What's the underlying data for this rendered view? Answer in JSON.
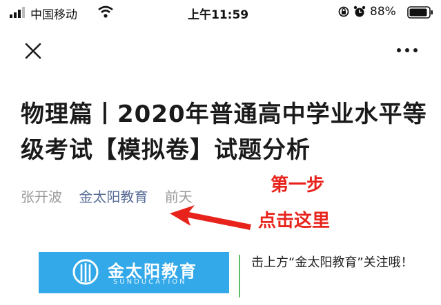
{
  "status_bar": {
    "carrier": "中国移动",
    "time": "上午11:59",
    "battery": "88%"
  },
  "article": {
    "title": "物理篇丨2020年普通高中学业水平等级考试【模拟卷】试题分析",
    "author": "张开波",
    "account": "金太阳教育",
    "date": "前天"
  },
  "annotation": {
    "step": "第一步",
    "instruction": "点击这里"
  },
  "banner": {
    "name": "金太阳教育",
    "subtitle": "SUNDUCATION",
    "follow_tip": "击上方“金太阳教育”关注哦！"
  },
  "colors": {
    "link": "#576b95",
    "annotation": "#e8231c",
    "banner": "#33a9e9"
  },
  "icons": [
    "signal-icon",
    "wifi-icon",
    "rotation-lock-icon",
    "alarm-icon",
    "battery-icon",
    "close-icon",
    "more-icon",
    "arrow-icon",
    "logo-icon"
  ]
}
